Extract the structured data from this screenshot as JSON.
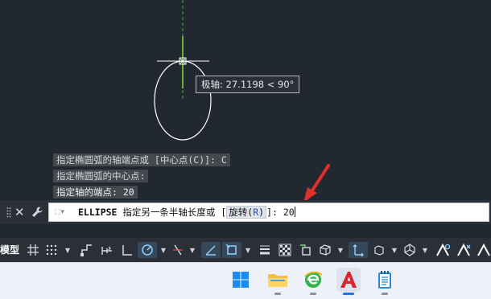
{
  "canvas": {
    "tooltip_text": "极轴: 27.1198 < 90°",
    "history": [
      "指定椭圆弧的轴端点或 [中心点(C)]: C",
      "指定椭圆弧的中心点:",
      "指定轴的端点: 20"
    ]
  },
  "command_line": {
    "command": "ELLIPSE",
    "prompt": "指定另一条半轴长度或 [",
    "option_text": "旋转",
    "option_key_open": "(",
    "option_key": "R",
    "option_key_close": ")",
    "prompt_end": "]:",
    "input_value": "20"
  },
  "status_bar": {
    "model_tab": "模型"
  },
  "colors": {
    "canvas_bg": "#212830",
    "arrow": "#e0302a",
    "crosshair_green": "#7ee03a",
    "ellipse": "#ffffff"
  },
  "icons": {
    "status": [
      "grid-icon",
      "snap-icon",
      "infer-constraints-icon",
      "dynamic-input-icon",
      "ortho-icon",
      "polar-tracking-icon",
      "isodraft-icon",
      "object-snap-tracking-icon",
      "object-snap-icon",
      "lineweight-icon",
      "transparency-icon",
      "selection-cycling-icon",
      "3d-object-snap-icon",
      "dynamic-ucs-icon",
      "selection-filter-icon",
      "gizmo-icon",
      "annotation-visibility-icon",
      "auto-scale-icon",
      "annotation-scale-icon"
    ],
    "taskbar": [
      "windows-start-icon",
      "file-explorer-icon",
      "browser-icon",
      "autocad-icon",
      "notepad-icon"
    ]
  }
}
